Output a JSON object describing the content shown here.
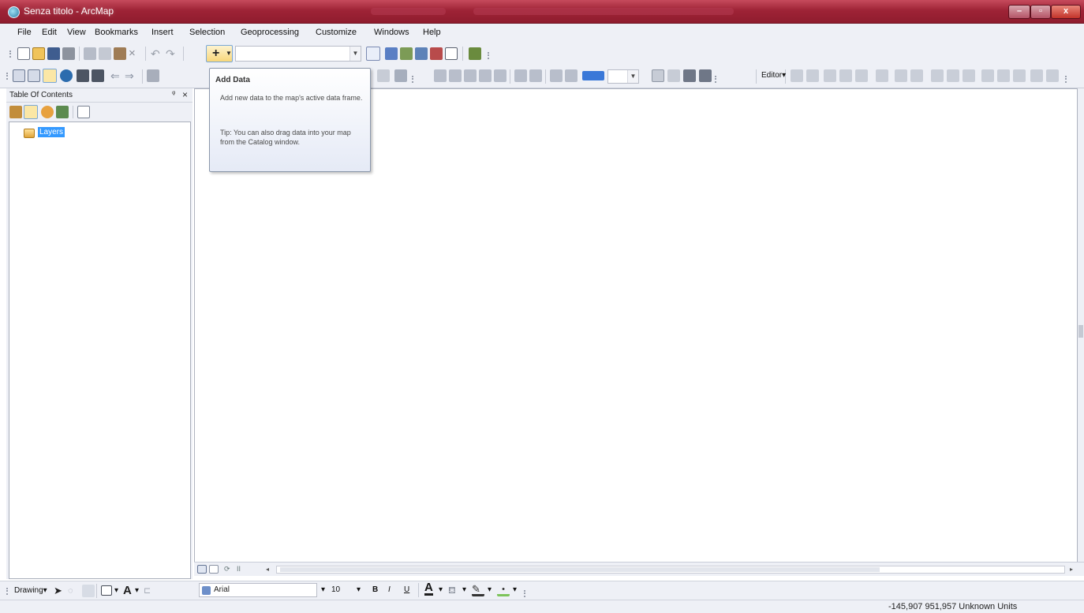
{
  "window": {
    "title": "Senza titolo - ArcMap"
  },
  "menu": {
    "items": [
      "File",
      "Edit",
      "View",
      "Bookmarks",
      "Insert",
      "Selection",
      "Geoprocessing",
      "Customize",
      "Windows",
      "Help"
    ]
  },
  "toolbar": {
    "editor_label": "Editor▾"
  },
  "tooltip": {
    "title": "Add Data",
    "description": "Add new data to the map's active data frame.",
    "tip": "Tip: You can also drag data into your map from the Catalog window."
  },
  "toc": {
    "title": "Table Of Contents",
    "pin": "ᵠ",
    "close": "×",
    "layers_label": "Layers"
  },
  "drawing": {
    "label": "Drawing▾",
    "font_name": "Arial",
    "font_size": "10",
    "bold": "B",
    "italic": "I",
    "underline": "U",
    "font_color": "A"
  },
  "status": {
    "coordinates": "-145,907  951,957 Unknown Units"
  },
  "colors": {
    "titlebar": "#9e2336",
    "selection": "#3399ff",
    "chrome": "#eef0f6"
  }
}
